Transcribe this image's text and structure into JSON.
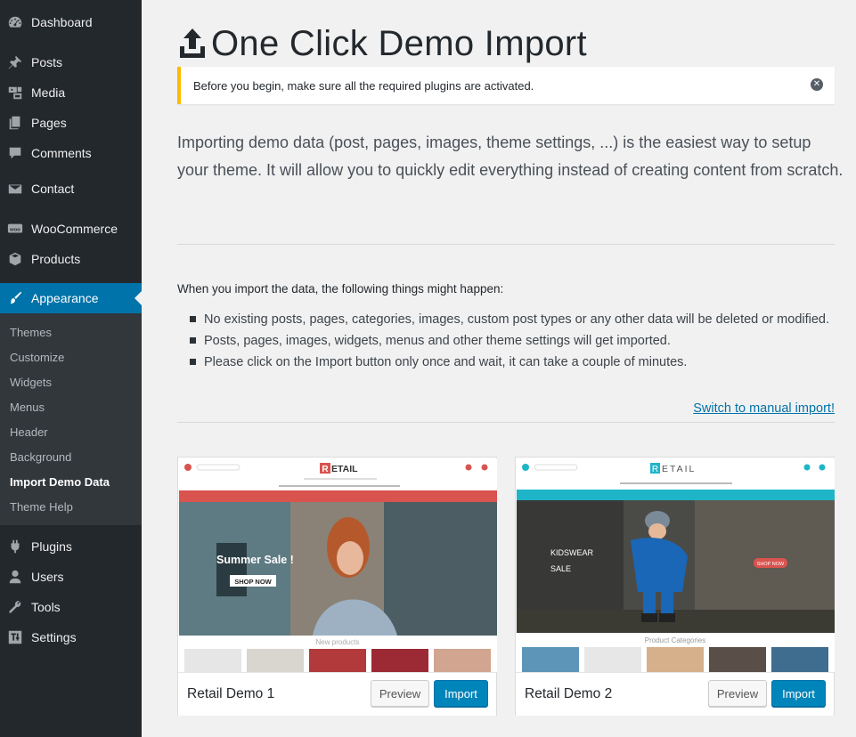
{
  "sidebar": {
    "items": [
      {
        "label": "Dashboard",
        "icon": "dashboard-icon"
      },
      {
        "label": "Posts",
        "icon": "pushpin-icon"
      },
      {
        "label": "Media",
        "icon": "media-icon"
      },
      {
        "label": "Pages",
        "icon": "pages-icon"
      },
      {
        "label": "Comments",
        "icon": "comment-icon"
      },
      {
        "label": "Contact",
        "icon": "mail-icon"
      },
      {
        "label": "WooCommerce",
        "icon": "woocommerce-icon"
      },
      {
        "label": "Products",
        "icon": "cube-icon"
      },
      {
        "label": "Appearance",
        "icon": "paintbrush-icon"
      },
      {
        "label": "Plugins",
        "icon": "plugin-icon"
      },
      {
        "label": "Users",
        "icon": "user-icon"
      },
      {
        "label": "Tools",
        "icon": "wrench-icon"
      },
      {
        "label": "Settings",
        "icon": "settings-icon"
      }
    ],
    "submenu": [
      "Themes",
      "Customize",
      "Widgets",
      "Menus",
      "Header",
      "Background",
      "Import Demo Data",
      "Theme Help"
    ],
    "submenu_current": "Import Demo Data"
  },
  "page": {
    "title": "One Click Demo Import",
    "notice": "Before you begin, make sure all the required plugins are activated.",
    "intro": "Importing demo data (post, pages, images, theme settings, ...) is the easiest way to setup your theme. It will allow you to quickly edit everything instead of creating content from scratch.",
    "happen_title": "When you import the data, the following things might happen:",
    "bullets": [
      "No existing posts, pages, categories, images, custom post types or any other data will be deleted or modified.",
      "Posts, pages, images, widgets, menus and other theme settings will get imported.",
      "Please click on the Import button only once and wait, it can take a couple of minutes."
    ],
    "manual_link": "Switch to manual import!"
  },
  "demos": [
    {
      "name": "Retail Demo 1",
      "preview_label": "Preview",
      "import_label": "Import",
      "shot": {
        "logo_r": "R",
        "logo_rest": "ETAIL",
        "banner_title": "Summer Sale !",
        "banner_button": "SHOP NOW",
        "section_title": "New products",
        "accent": "#d9534f"
      }
    },
    {
      "name": "Retail Demo 2",
      "preview_label": "Preview",
      "import_label": "Import",
      "shot": {
        "logo_r": "R",
        "logo_rest": "ETAIL",
        "banner_title": "KIDSWEAR",
        "banner_subtitle": "SALE",
        "banner_button": "SHOP NOW",
        "section_title": "Product Categories",
        "accent": "#1fb5c8"
      }
    }
  ],
  "colors": {
    "sidebar_bg": "#23282d",
    "active": "#0073aa",
    "notice_warning": "#ffb900",
    "button_primary": "#0085ba"
  }
}
